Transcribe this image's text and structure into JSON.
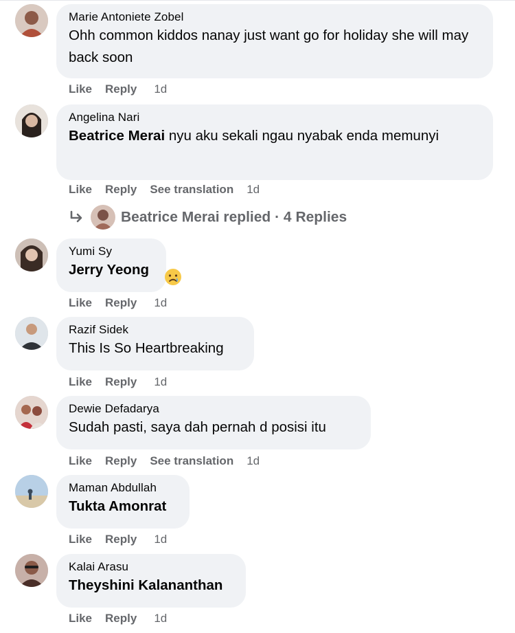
{
  "actions": {
    "like": "Like",
    "reply": "Reply",
    "see_translation": "See translation"
  },
  "comments": [
    {
      "author": "Marie Antoniete Zobel",
      "text": "Ohh common kiddos nanay just want go for holiday she will may back soon",
      "time": "1d",
      "avatar_color": "#b0503a"
    },
    {
      "author": "Angelina Nari",
      "mention": "Beatrice Merai",
      "text": " nyu aku sekali ngau nyabak enda memunyi",
      "time": "1d",
      "avatar_color": "#6b5b52"
    },
    {
      "author": "Yumi Sy",
      "mention": "Jerry Yeong",
      "emoji": "sad-crying-face-emoji",
      "time": "1d",
      "avatar_color": "#5a4a40"
    },
    {
      "author": "Razif Sidek",
      "text": "This Is So Heartbreaking",
      "time": "1d",
      "avatar_color": "#8a9aa6"
    },
    {
      "author": "Dewie Defadarya",
      "text": "Sudah pasti, saya dah pernah d posisi itu",
      "time": "1d",
      "avatar_color": "#b07a6a"
    },
    {
      "author": "Maman Abdullah",
      "mention": "Tukta Amonrat",
      "time": "1d",
      "avatar_color": "#7fa2c4"
    },
    {
      "author": "Kalai Arasu",
      "mention": "Theyshini Kalananthan",
      "time": "1d",
      "avatar_color": "#6a4a44"
    }
  ],
  "replies_summary": {
    "text": "Beatrice Merai replied · 4 Replies",
    "avatar_color": "#7a5248"
  },
  "colors": {
    "bubble_bg": "#f0f2f5",
    "secondary_text": "#65676b",
    "primary_text": "#050505"
  }
}
